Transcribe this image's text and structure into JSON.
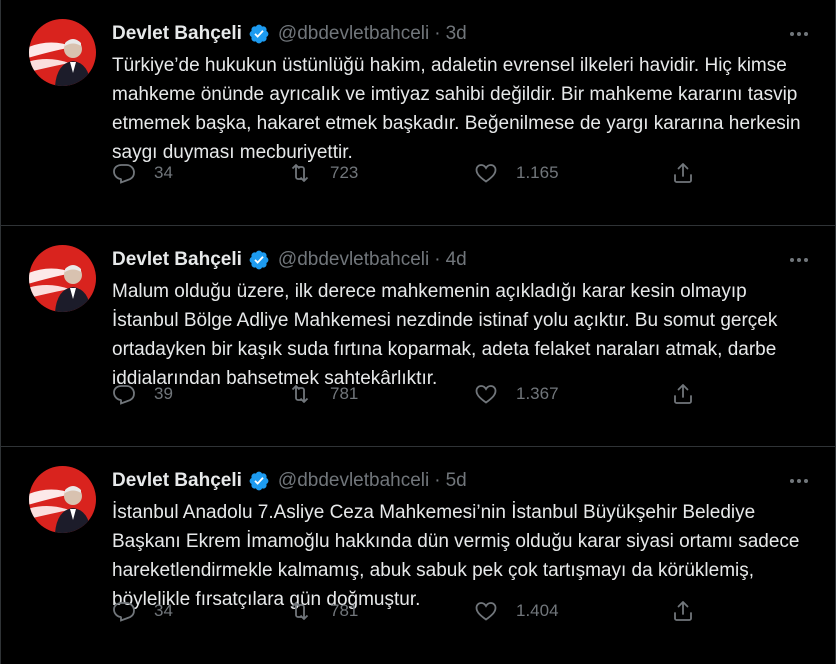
{
  "colors": {
    "background": "#000000",
    "text": "#e7e9ea",
    "muted": "#71767b",
    "divider": "#2f3336",
    "verified": "#1d9bf0"
  },
  "icons": {
    "reply": "reply-icon",
    "retweet": "retweet-icon",
    "like": "like-icon",
    "share": "share-icon",
    "more": "more-icon",
    "verified": "verified-badge-icon"
  },
  "tweets": [
    {
      "name": "Devlet Bahçeli",
      "handle": "@dbdevletbahceli",
      "separator": "·",
      "time": "3d",
      "text": "Türkiye’de hukukun üstünlüğü hakim, adaletin evrensel ilkeleri havidir. Hiç kimse mahkeme önünde ayrıcalık ve imtiyaz sahibi değildir. Bir mahkeme kararını tasvip etmemek başka, hakaret etmek başkadır. Beğenilmese de yargı kararına herkesin saygı duyması mecburiyettir.",
      "replies": "34",
      "retweets": "723",
      "likes": "1.165"
    },
    {
      "name": "Devlet Bahçeli",
      "handle": "@dbdevletbahceli",
      "separator": "·",
      "time": "4d",
      "text": "Malum olduğu üzere, ilk derece mahkemenin açıkladığı karar kesin olmayıp İstanbul Bölge Adliye Mahkemesi nezdinde istinaf yolu açıktır. Bu somut gerçek ortadayken bir kaşık suda fırtına koparmak, adeta felaket naraları atmak, darbe iddialarından bahsetmek sahtekârlıktır.",
      "replies": "39",
      "retweets": "781",
      "likes": "1.367"
    },
    {
      "name": "Devlet Bahçeli",
      "handle": "@dbdevletbahceli",
      "separator": "·",
      "time": "5d",
      "text": "İstanbul Anadolu 7.Asliye Ceza Mahkemesi’nin İstanbul Büyükşehir Belediye Başkanı Ekrem İmamoğlu hakkında dün vermiş olduğu karar siyasi ortamı sadece hareketlendirmekle kalmamış, abuk sabuk pek çok tartışmayı da körüklemiş, böylelikle fırsatçılara gün doğmuştur.",
      "replies": "34",
      "retweets": "781",
      "likes": "1.404"
    }
  ]
}
